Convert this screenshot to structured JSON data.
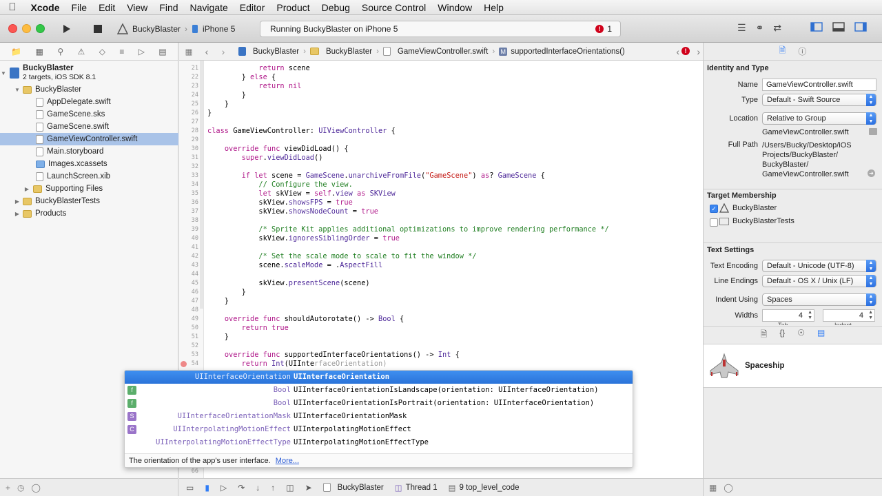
{
  "menubar": {
    "items": [
      "Xcode",
      "File",
      "Edit",
      "View",
      "Find",
      "Navigate",
      "Editor",
      "Product",
      "Debug",
      "Source Control",
      "Window",
      "Help"
    ]
  },
  "toolbar": {
    "scheme": "BuckyBlaster",
    "device": "iPhone 5",
    "status": "Running BuckyBlaster on iPhone 5",
    "error_count": "1"
  },
  "navigator": {
    "project_name": "BuckyBlaster",
    "project_sub": "2 targets, iOS SDK 8.1",
    "items": [
      {
        "label": "BuckyBlaster",
        "kind": "folder"
      },
      {
        "label": "AppDelegate.swift",
        "kind": "file"
      },
      {
        "label": "GameScene.sks",
        "kind": "file"
      },
      {
        "label": "GameScene.swift",
        "kind": "file"
      },
      {
        "label": "GameViewController.swift",
        "kind": "file"
      },
      {
        "label": "Main.storyboard",
        "kind": "file"
      },
      {
        "label": "Images.xcassets",
        "kind": "file"
      },
      {
        "label": "LaunchScreen.xib",
        "kind": "file"
      },
      {
        "label": "Supporting Files",
        "kind": "folder"
      },
      {
        "label": "BuckyBlasterTests",
        "kind": "folder"
      },
      {
        "label": "Products",
        "kind": "folder"
      }
    ]
  },
  "jumpbar": {
    "project": "BuckyBlaster",
    "group": "BuckyBlaster",
    "file": "GameViewController.swift",
    "symbol": "supportedInterfaceOrientations()"
  },
  "code": {
    "line_numbers": [
      "21",
      "22",
      "23",
      "24",
      "25",
      "26",
      "27",
      "28",
      "29",
      "30",
      "31",
      "32",
      "33",
      "34",
      "35",
      "36",
      "37",
      "38",
      "39",
      "40",
      "41",
      "42",
      "43",
      "44",
      "45",
      "46",
      "47",
      "48",
      "49",
      "50",
      "51",
      "52",
      "53",
      "54"
    ],
    "last_line_number": "66"
  },
  "autocomplete": {
    "rows": [
      {
        "badge": "",
        "ret": "UIInterfaceOrientation",
        "name": "UIInterfaceOrientation",
        "color": "#2a73d9"
      },
      {
        "badge": "f",
        "ret": "Bool",
        "name": "UIInterfaceOrientationIsLandscape(orientation: UIInterfaceOrientation)",
        "color": "#5bae6b"
      },
      {
        "badge": "f",
        "ret": "Bool",
        "name": "UIInterfaceOrientationIsPortrait(orientation: UIInterfaceOrientation)",
        "color": "#5bae6b"
      },
      {
        "badge": "S",
        "ret": "UIInterfaceOrientationMask",
        "name": "UIInterfaceOrientationMask",
        "color": "#9a74c9"
      },
      {
        "badge": "C",
        "ret": "UIInterpolatingMotionEffect",
        "name": "UIInterpolatingMotionEffect",
        "color": "#9a74c9"
      },
      {
        "badge": "",
        "ret": "UIInterpolatingMotionEffectType",
        "name": "UIInterpolatingMotionEffectType",
        "color": "#9a74c9"
      }
    ],
    "doc": "The orientation of the app's user interface.",
    "more": "More..."
  },
  "debugbar": {
    "target": "BuckyBlaster",
    "thread": "Thread 1",
    "frame": "9 top_level_code"
  },
  "inspector": {
    "identity_title": "Identity and Type",
    "name_label": "Name",
    "name_value": "GameViewController.swift",
    "type_label": "Type",
    "type_value": "Default - Swift Source",
    "location_label": "Location",
    "location_value": "Relative to Group",
    "location_file": "GameViewController.swift",
    "fullpath_label": "Full Path",
    "fullpath_value": "/Users/Bucky/Desktop/iOS Projects/BuckyBlaster/ BuckyBlaster/ GameViewController.swift",
    "target_title": "Target Membership",
    "targets": [
      {
        "label": "BuckyBlaster",
        "checked": true
      },
      {
        "label": "BuckyBlasterTests",
        "checked": false
      }
    ],
    "text_title": "Text Settings",
    "encoding_label": "Text Encoding",
    "encoding_value": "Default - Unicode (UTF-8)",
    "endings_label": "Line Endings",
    "endings_value": "Default - OS X / Unix (LF)",
    "indent_label": "Indent Using",
    "indent_value": "Spaces",
    "widths_label": "Widths",
    "tab_width": "4",
    "indent_width": "4",
    "tab_caption": "Tab",
    "indent_caption": "Indent",
    "library_item": "Spaceship"
  }
}
